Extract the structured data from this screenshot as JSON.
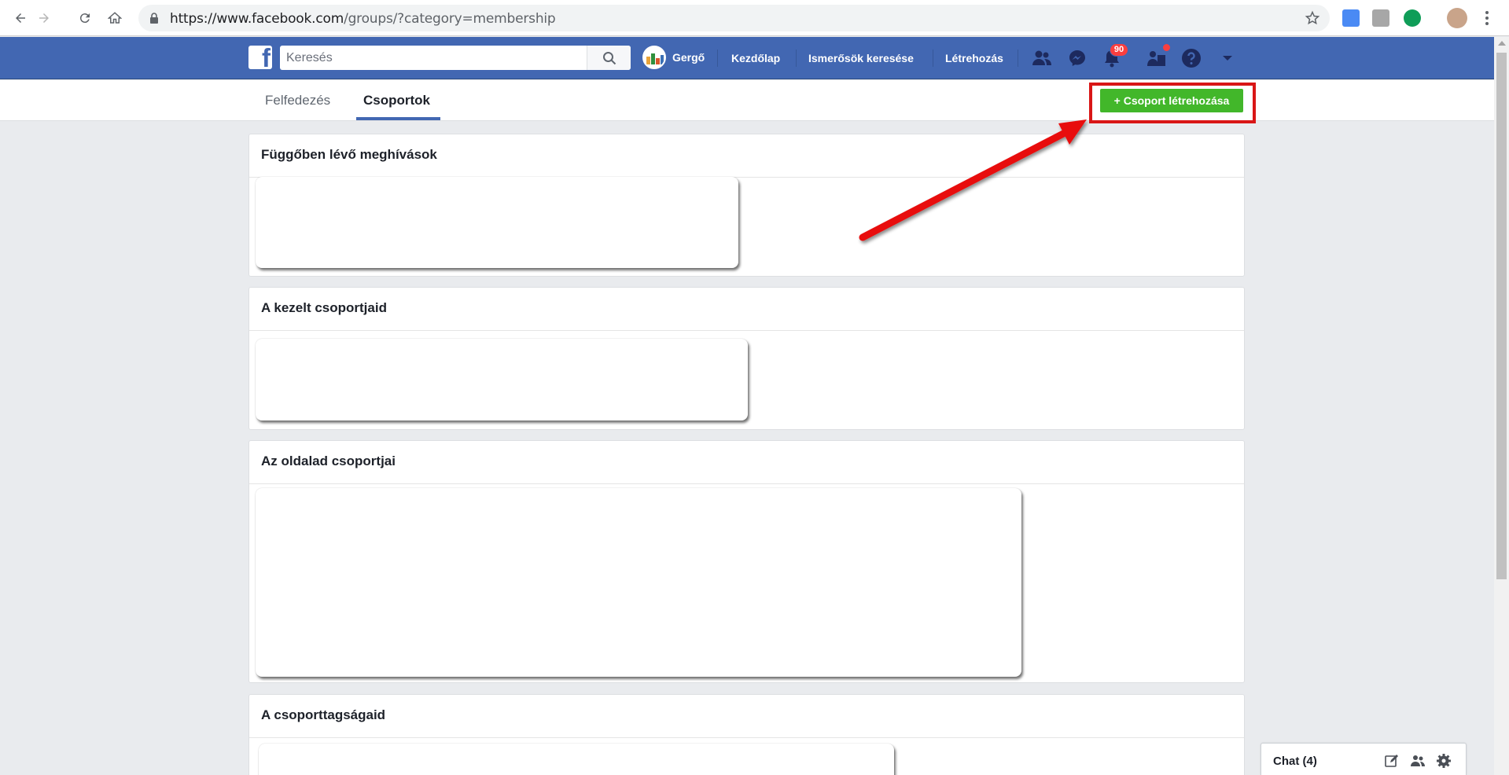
{
  "browser": {
    "url_host": "https://www.facebook.com",
    "url_path": "/groups/?category=membership"
  },
  "facebook": {
    "logo": "f",
    "search_placeholder": "Keresés",
    "profile_name": "Gergő",
    "nav": {
      "home": "Kezdőlap",
      "find_friends": "Ismerősök keresése",
      "create": "Létrehozás"
    },
    "notifications_count": "90"
  },
  "tabs": {
    "discover": "Felfedezés",
    "groups": "Csoportok"
  },
  "create_group_button": "+ Csoport létrehozása",
  "sections": {
    "pending": "Függőben lévő meghívások",
    "managed": "A kezelt csoportjaid",
    "page_groups": "Az oldalad csoportjai",
    "memberships": "A csoporttagságaid"
  },
  "chat": {
    "label": "Chat (4)"
  },
  "colors": {
    "fb_blue": "#4267b2",
    "green": "#42b72a",
    "highlight_red": "#d91616"
  }
}
